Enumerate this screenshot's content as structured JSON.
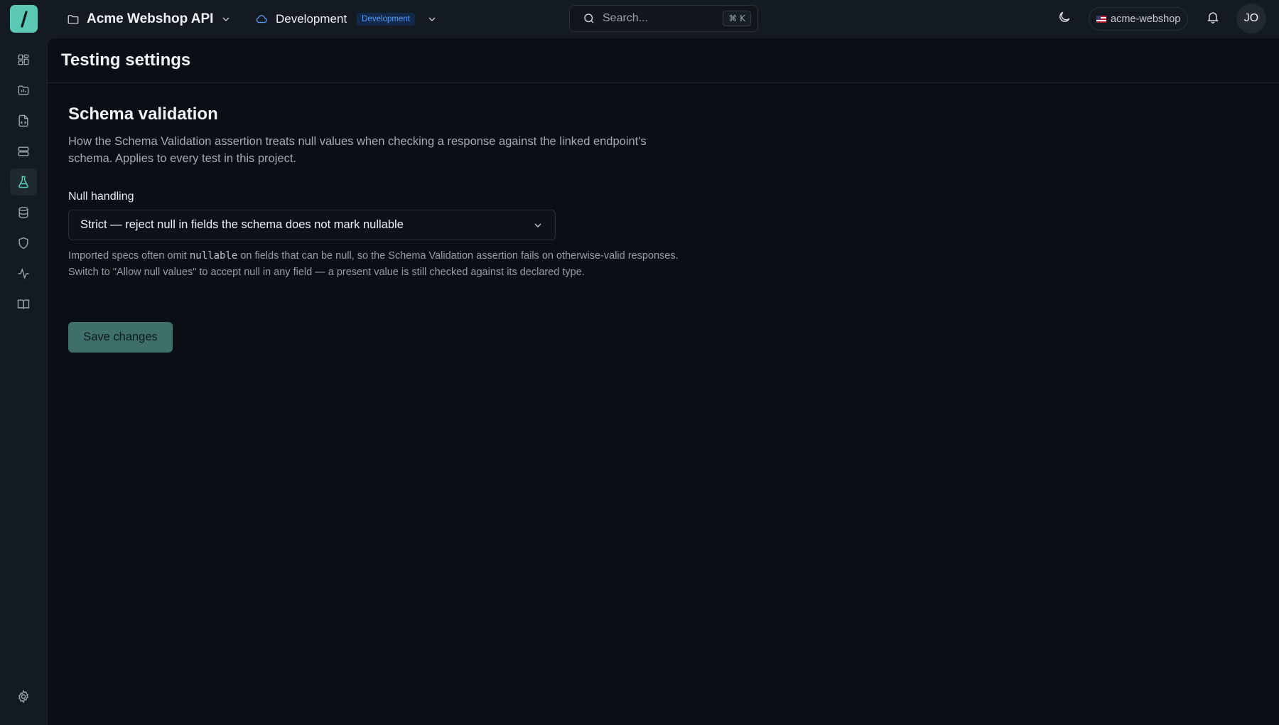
{
  "topbar": {
    "project_name": "Acme Webshop API",
    "environment_name": "Development",
    "environment_badge": "Development",
    "search_placeholder": "Search...",
    "search_shortcut": "⌘ K",
    "workspace_name": "acme-webshop",
    "avatar_initials": "JO"
  },
  "sidebar": {
    "items": [
      {
        "icon": "dashboard-icon",
        "active": false
      },
      {
        "icon": "reports-icon",
        "active": false
      },
      {
        "icon": "api-spec-icon",
        "active": false
      },
      {
        "icon": "endpoints-icon",
        "active": false
      },
      {
        "icon": "testing-flask-icon",
        "active": true
      },
      {
        "icon": "database-icon",
        "active": false
      },
      {
        "icon": "shield-icon",
        "active": false
      },
      {
        "icon": "activity-icon",
        "active": false
      },
      {
        "icon": "docs-book-icon",
        "active": false
      }
    ],
    "settings_icon": "gear-icon"
  },
  "page": {
    "title": "Testing settings",
    "section_title": "Schema validation",
    "section_description": "How the Schema Validation assertion treats null values when checking a response against the linked endpoint's schema. Applies to every test in this project.",
    "null_handling_label": "Null handling",
    "null_handling_value": "Strict — reject null in fields the schema does not mark nullable",
    "help_before": "Imported specs often omit ",
    "help_code": "nullable",
    "help_after": " on fields that can be null, so the Schema Validation assertion fails on otherwise-valid responses. Switch to \"Allow null values\" to accept null in any field — a present value is still checked against its declared type.",
    "save_label": "Save changes"
  },
  "colors": {
    "accent": "#5cc9b4",
    "save_button": "#3f6f6b",
    "env_badge_bg": "#13294a",
    "env_badge_text": "#5b9cf4",
    "background": "#0a0e15"
  }
}
